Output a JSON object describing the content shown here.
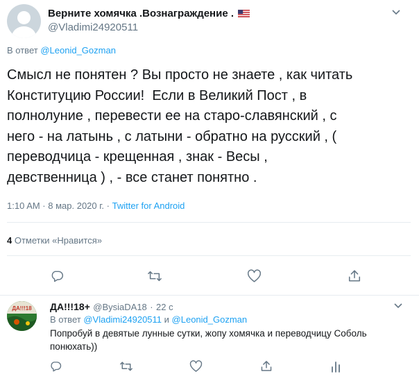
{
  "tweet": {
    "author_name": "Верните хомячка .Вознаграждение .",
    "author_handle": "@Vladimi24920511",
    "reply_prefix": "В ответ",
    "reply_to": "@Leonid_Gozman",
    "text": "Смысл не понятен ? Вы просто не знаете , как читать\nКонституцию России!  Если в Великий Пост , в\nполнолуние , перевести ее на старо-славянский , с\nнего - на латынь , с латыни - обратно на русский , (\nпереводчица - крещенная , знак - Весы ,\nдевственница ) , - все станет понятно .",
    "timestamp": "1:10 AM · 8 мар. 2020 г.",
    "separator": "·",
    "source": "Twitter for Android",
    "likes_count": "4",
    "likes_label": "Отметки «Нравится»",
    "icons": [
      "chevron-down-icon",
      "reply-icon",
      "retweet-icon",
      "like-icon",
      "share-icon"
    ]
  },
  "reply": {
    "author_name": "ДА!!!18+",
    "author_handle": "@BysiaDA18",
    "dot": "·",
    "time": "22 с",
    "reply_prefix": "В ответ",
    "reply_to_1": "@Vladimi24920511",
    "conj": "и",
    "reply_to_2": "@Leonid_Gozman",
    "text": "Попробуй в девятые лунные сутки, жопу хомячка и переводчицу Соболь понюхать))",
    "avatar_text": "ДА!!!18",
    "icons": [
      "reply-icon",
      "retweet-icon",
      "like-icon",
      "share-icon",
      "analytics-icon",
      "chevron-down-icon"
    ]
  },
  "colors": {
    "accent": "#1da1f2",
    "secondary": "#657786",
    "divider": "#e6ecf0"
  }
}
